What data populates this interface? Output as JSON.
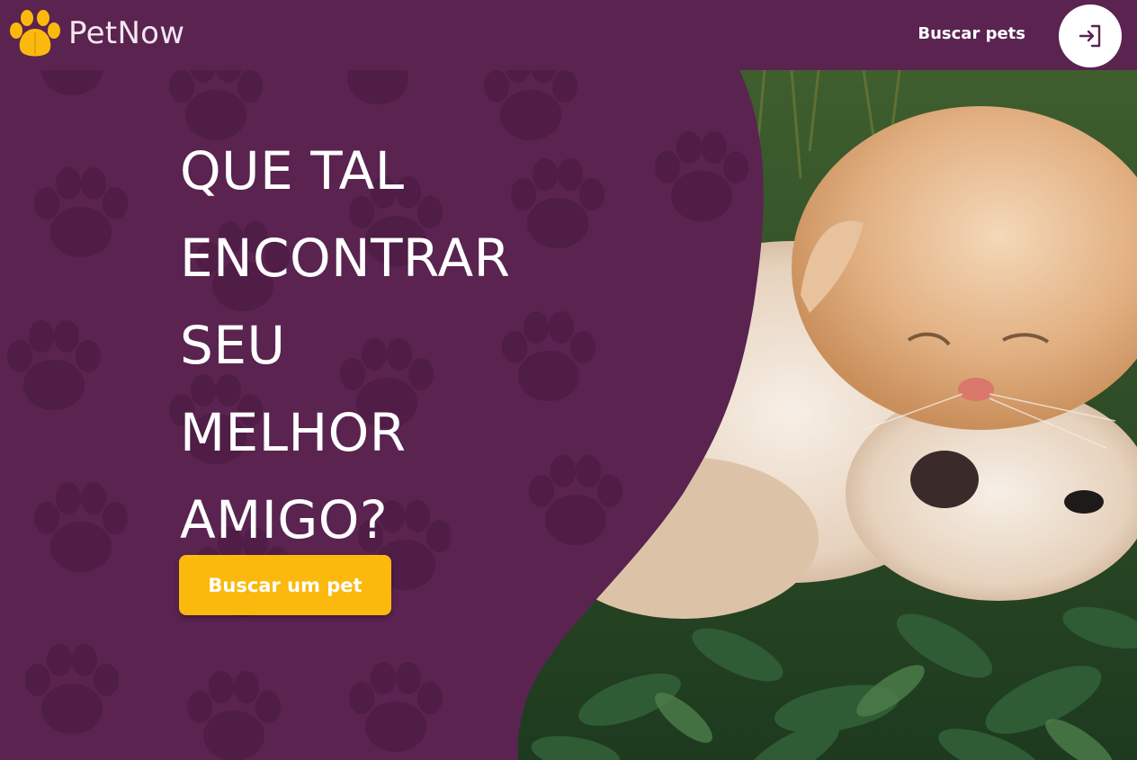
{
  "header": {
    "brand_part1": "Pet",
    "brand_part2": "Now",
    "logo_icon": "paw-icon",
    "nav_link_label": "Buscar pets",
    "login_icon": "login-arrow-icon"
  },
  "hero": {
    "headline_lines": [
      "QUE TAL",
      "ENCONTRAR",
      "SEU",
      "MELHOR",
      "AMIGO?"
    ],
    "cta_label": "Buscar um pet",
    "photo_subject": "cat-and-dog-photo"
  },
  "colors": {
    "background": "#5a2350",
    "paw_pattern": "#4f1d46",
    "accent": "#fbb90d",
    "text": "#ffffff"
  }
}
